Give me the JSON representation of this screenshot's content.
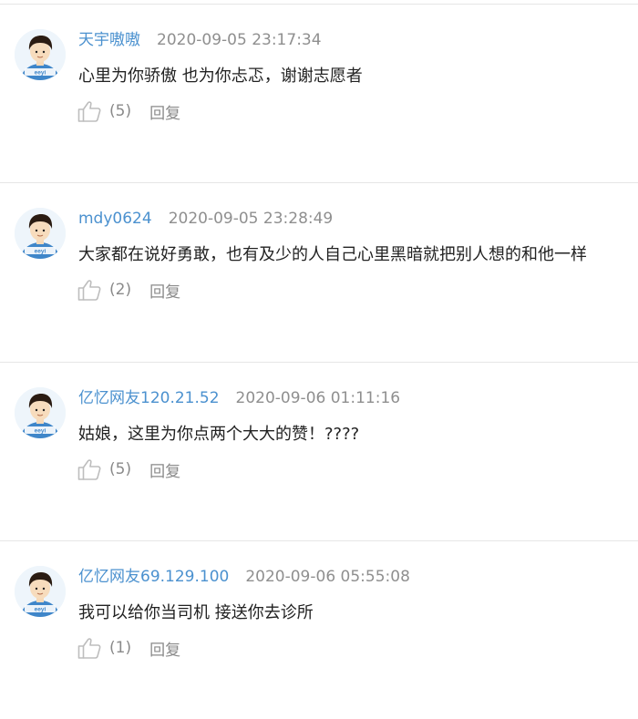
{
  "comments": [
    {
      "username": "天宇嗷嗷",
      "time": "2020-09-05 23:17:34",
      "content": "心里为你骄傲 也为你忐忑，谢谢志愿者",
      "like_count": "(5)",
      "reply_label": "回复",
      "avatar_icon": "user-avatar-icon",
      "like_icon": "thumbs-up-icon"
    },
    {
      "username": "mdy0624",
      "time": "2020-09-05 23:28:49",
      "content": "大家都在说好勇敢，也有及少的人自己心里黑暗就把别人想的和他一样",
      "like_count": "(2)",
      "reply_label": "回复",
      "avatar_icon": "user-avatar-icon",
      "like_icon": "thumbs-up-icon"
    },
    {
      "username": "亿忆网友120.21.52",
      "time": "2020-09-06 01:11:16",
      "content": "姑娘，这里为你点两个大大的赞！????",
      "like_count": "(5)",
      "reply_label": "回复",
      "avatar_icon": "user-avatar-icon",
      "like_icon": "thumbs-up-icon"
    },
    {
      "username": "亿忆网友69.129.100",
      "time": "2020-09-06 05:55:08",
      "content": "我可以给你当司机 接送你去诊所",
      "like_count": "(1)",
      "reply_label": "回复",
      "avatar_icon": "user-avatar-icon",
      "like_icon": "thumbs-up-icon"
    }
  ],
  "colors": {
    "username": "#4b91cf",
    "time": "#8f8f8f",
    "content": "#222222",
    "action": "#8a8a8a",
    "divider": "#e6e6e6"
  }
}
